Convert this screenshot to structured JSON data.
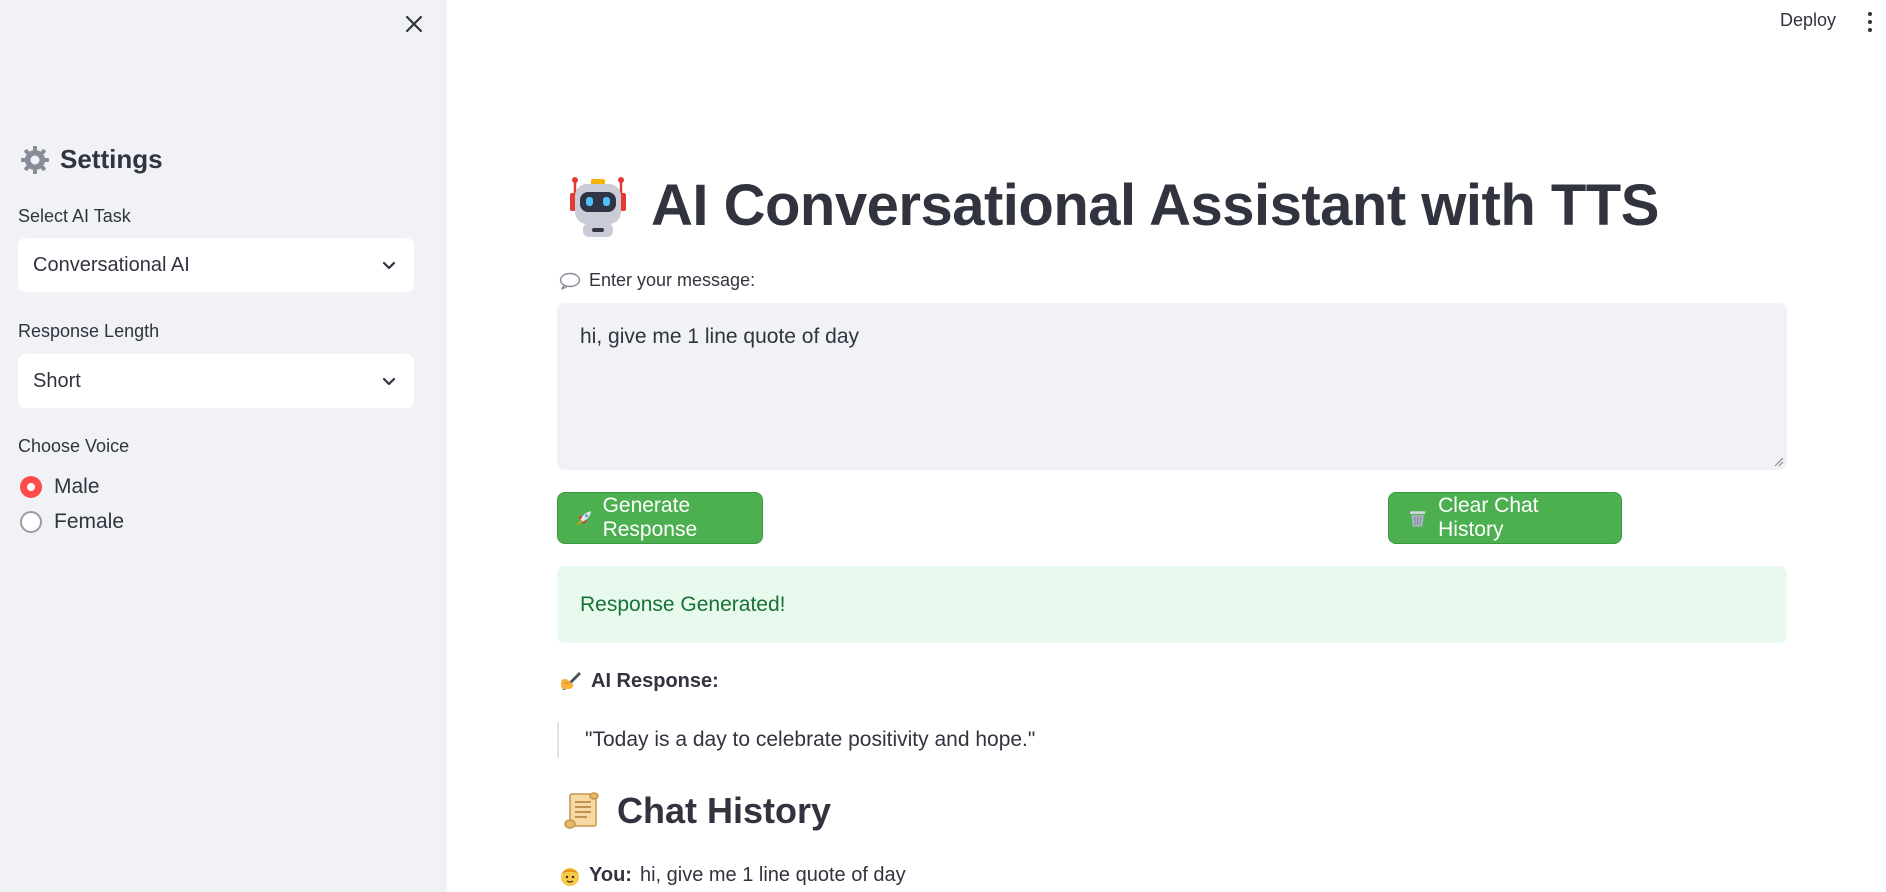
{
  "topbar": {
    "deploy_label": "Deploy"
  },
  "sidebar": {
    "title": "Settings",
    "task": {
      "label": "Select AI Task",
      "value": "Conversational AI"
    },
    "length": {
      "label": "Response Length",
      "value": "Short"
    },
    "voice": {
      "label": "Choose Voice",
      "options": [
        {
          "label": "Male",
          "selected": true
        },
        {
          "label": "Female",
          "selected": false
        }
      ]
    }
  },
  "main": {
    "title": "AI Conversational Assistant with TTS",
    "message_label": "Enter your message:",
    "message_value": "hi, give me 1 line quote of day",
    "generate_label": "Generate Response",
    "clear_label": "Clear Chat History",
    "success_text": "Response Generated!",
    "response_label": "AI Response:",
    "response_text": "\"Today is a day to celebrate positivity and hope.\"",
    "history_title": "Chat History",
    "history": [
      {
        "speaker": "You:",
        "text": "hi, give me 1 line quote of day"
      }
    ]
  },
  "colors": {
    "primary_button": "#4caf50",
    "radio_accent": "#ff4b4b",
    "success_bg": "#e8f9ee",
    "success_text": "#177233",
    "sidebar_bg": "#f0f2f6"
  },
  "icons": [
    "close-icon",
    "gear-icon",
    "chevron-down-icon",
    "robot-icon",
    "speech-bubble-icon",
    "rocket-icon",
    "trash-icon",
    "writing-hand-icon",
    "scroll-icon",
    "person-icon",
    "kebab-menu-icon"
  ]
}
